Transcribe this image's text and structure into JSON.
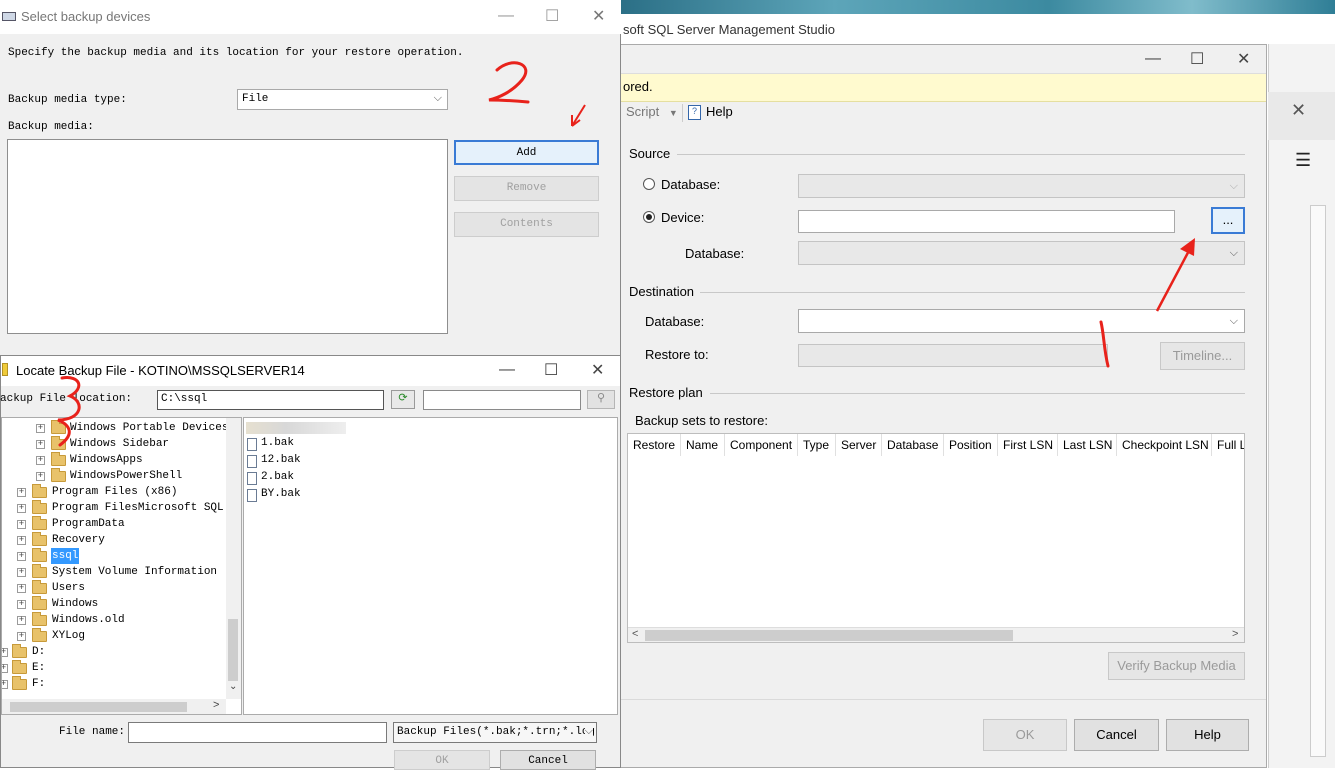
{
  "ssms": {
    "app_title": "soft SQL Server Management Studio"
  },
  "restore": {
    "info_text": "ored.",
    "toolbar": {
      "script_label": "Script",
      "help_label": "Help"
    },
    "source": {
      "heading": "Source",
      "database_radio_label": "Database:",
      "device_radio_label": "Device:",
      "device_browse_label": "...",
      "device_database_label": "Database:",
      "selected_option": "Device"
    },
    "destination": {
      "heading": "Destination",
      "database_label": "Database:",
      "restore_to_label": "Restore to:",
      "timeline_label": "Timeline..."
    },
    "restore_plan": {
      "heading": "Restore plan",
      "sets_label": "Backup sets to restore:",
      "columns": [
        "Restore",
        "Name",
        "Component",
        "Type",
        "Server",
        "Database",
        "Position",
        "First LSN",
        "Last LSN",
        "Checkpoint LSN",
        "Full LS"
      ]
    },
    "verify_label": "Verify Backup Media",
    "ok_label": "OK",
    "cancel_label": "Cancel",
    "help_button_label": "Help"
  },
  "devices": {
    "title": "Select backup devices",
    "instruction": "Specify the backup media and its location for your restore operation.",
    "media_type_label": "Backup media type:",
    "media_type_value": "File",
    "media_label": "Backup media:",
    "add_label": "Add",
    "remove_label": "Remove",
    "contents_label": "Contents"
  },
  "locate": {
    "title": "Locate Backup File - KOTINO\\MSSQLSERVER14",
    "location_label": "ackup File location:",
    "location_value": "C:\\ssql",
    "tree": [
      {
        "label": "Windows Portable Devices",
        "level": 2
      },
      {
        "label": "Windows Sidebar",
        "level": 2
      },
      {
        "label": "WindowsApps",
        "level": 2
      },
      {
        "label": "WindowsPowerShell",
        "level": 2
      },
      {
        "label": "Program Files (x86)",
        "level": 1
      },
      {
        "label": "Program FilesMicrosoft SQL Se",
        "level": 1
      },
      {
        "label": "ProgramData",
        "level": 1
      },
      {
        "label": "Recovery",
        "level": 1
      },
      {
        "label": "ssql",
        "level": 1,
        "selected": true
      },
      {
        "label": "System Volume Information",
        "level": 1
      },
      {
        "label": "Users",
        "level": 1
      },
      {
        "label": "Windows",
        "level": 1
      },
      {
        "label": "Windows.old",
        "level": 1
      },
      {
        "label": "XYLog",
        "level": 1
      },
      {
        "label": "D:",
        "level": 0
      },
      {
        "label": "E:",
        "level": 0
      },
      {
        "label": "F:",
        "level": 0
      }
    ],
    "files": [
      "1.bak",
      "12.bak",
      "2.bak",
      "BY.bak"
    ],
    "file_name_label": "File name:",
    "file_type_value": "Backup Files(*.bak;*.trn;*.log",
    "ok_label": "OK",
    "cancel_label": "Cancel"
  },
  "annotations": {
    "step1": "1",
    "step2": "2",
    "step3": "3",
    "color": "#e8221b"
  }
}
